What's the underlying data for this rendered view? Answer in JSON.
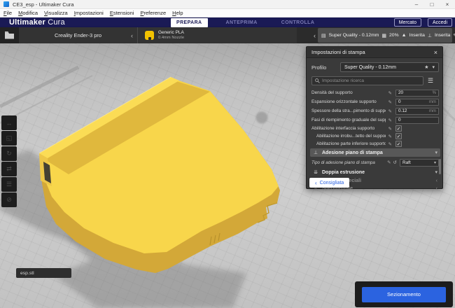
{
  "colors": {
    "accent_blue": "#2b63e0",
    "header_navy": "#1a1a55",
    "model_yellow": "#f8d64b",
    "model_yellow_dark": "#d3a838",
    "model_yellow_mid": "#e0b83d"
  },
  "window": {
    "title": "CE3_esp - Ultimaker Cura",
    "minimize": "–",
    "maximize": "□",
    "close": "×"
  },
  "menubar": {
    "items": [
      "File",
      "Modifica",
      "Visualizza",
      "Impostazioni",
      "Estensioni",
      "Preferenze",
      "Help"
    ]
  },
  "header": {
    "brand_bold": "Ultimaker",
    "brand_light": "Cura",
    "tab_prepare": "PREPARA",
    "tab_preview": "ANTEPRIMA",
    "tab_monitor": "CONTROLLA",
    "marketplace": "Mercato",
    "signin": "Accedi"
  },
  "toolbar": {
    "printer_name": "Creality Ender-3 pro",
    "material_name": "Generic PLA",
    "nozzle": "0.4mm Nozzle",
    "quality": "Super Quality - 0.12mm",
    "infill": "20%",
    "support": "Inserita",
    "adhesion": "Inserita"
  },
  "panel": {
    "title": "Impostazioni di stampa",
    "profile_label": "Profilo",
    "profile_value": "Super Quality - 0.12mm",
    "search_placeholder": "Impostazione ricerca",
    "rows": [
      {
        "label": "Densità del supporto",
        "value": "20",
        "unit": "%"
      },
      {
        "label": "Espansione orizzontale supporto",
        "value": "0",
        "unit": "mm"
      },
      {
        "label": "Spessore della stra...pimento di supporto",
        "value": "0.12",
        "unit": "mm"
      },
      {
        "label": "Fasi di riempimento graduale del supporto",
        "value": "0",
        "unit": ""
      }
    ],
    "checks": [
      {
        "label": "Abilitazione interfaccia supporto"
      },
      {
        "label": "Abilitazione irrobu...tetto del supporto"
      },
      {
        "label": "Abilitazione parte inferiore supporto"
      }
    ],
    "adhesion_section": "Adesione piano di stampa",
    "adhesion_type_label": "Tipo di adesione piano di stampa",
    "adhesion_type_value": "Raft",
    "section_dual": "Doppia estrusione",
    "section_special": "Modalità speciali",
    "section_experimental": "Sperimentale",
    "back_button": "Consigliata"
  },
  "viewport": {
    "object_list_item": "esp.stl"
  },
  "slice_button": "Sezionamento",
  "icons": {
    "check": "✓",
    "pencil": "✎",
    "star": "★",
    "chevron_down": "▾",
    "chevron_left": "‹",
    "hamburger": "☰",
    "undo": "↺",
    "quality": "▤",
    "infill": "▦",
    "support": "▲",
    "adhesion": "⊥",
    "move": "↔",
    "scale": "◱",
    "rotate": "↻",
    "mirror": "⇄",
    "per_model": "☰",
    "blocker": "⊘",
    "dual": "⇊",
    "special": "◧",
    "experimental": "◬"
  }
}
